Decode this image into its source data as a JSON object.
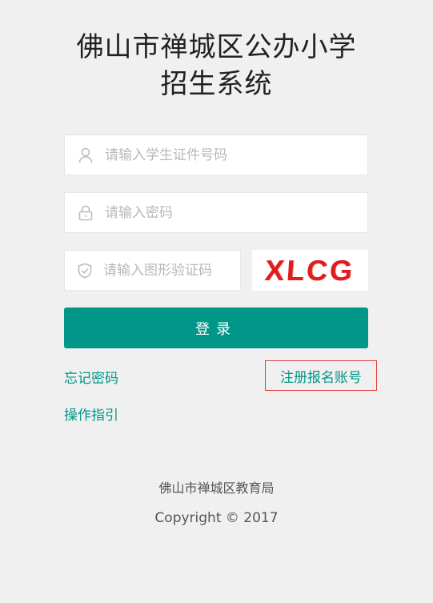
{
  "title": {
    "line1": "佛山市禅城区公办小学",
    "line2": "招生系统"
  },
  "form": {
    "id_placeholder": "请输入学生证件号码",
    "password_placeholder": "请输入密码",
    "captcha_placeholder": "请输入图形验证码",
    "captcha_text": "XLCG",
    "login_label": "登录"
  },
  "links": {
    "forgot": "忘记密码",
    "register": "注册报名账号",
    "guide": "操作指引"
  },
  "footer": {
    "org": "佛山市禅城区教育局",
    "copyright": "Copyright © 2017"
  },
  "icons": {
    "user": "user-icon",
    "lock": "lock-icon",
    "shield": "shield-check-icon"
  },
  "colors": {
    "accent": "#009688",
    "captcha": "#e21c1c",
    "highlight_border": "#e23a3a",
    "background": "#f0f0f0"
  }
}
